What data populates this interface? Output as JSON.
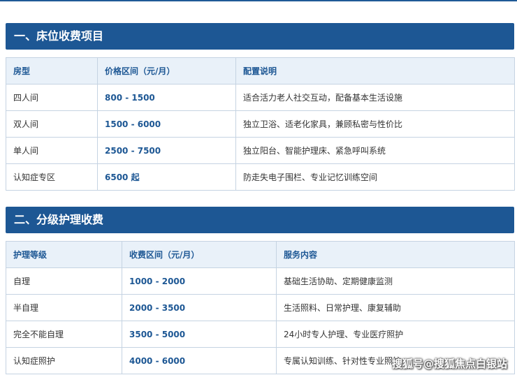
{
  "section1": {
    "title": "一、床位收费项目",
    "headers": [
      "房型",
      "价格区间（元/月）",
      "配置说明"
    ],
    "rows": [
      {
        "type": "四人间",
        "price": "800 - 1500",
        "desc": "适合活力老人社交互动，配备基本生活设施"
      },
      {
        "type": "双人间",
        "price": "1500 - 6000",
        "desc": "独立卫浴、适老化家具，兼顾私密与性价比"
      },
      {
        "type": "单人间",
        "price": "2500 - 7500",
        "desc": "独立阳台、智能护理床、紧急呼叫系统"
      },
      {
        "type": "认知症专区",
        "price": "6500 起",
        "desc": "防走失电子围栏、专业记忆训练空间"
      }
    ]
  },
  "section2": {
    "title": "二、分级护理收费",
    "headers": [
      "护理等级",
      "收费区间（元/月）",
      "服务内容"
    ],
    "rows": [
      {
        "level": "自理",
        "price": "1000 - 2000",
        "desc": "基础生活协助、定期健康监测"
      },
      {
        "level": "半自理",
        "price": "2000 - 3500",
        "desc": "生活照料、日常护理、康复辅助"
      },
      {
        "level": "完全不能自理",
        "price": "3500 - 5000",
        "desc": "24小时专人护理、专业医疗照护"
      },
      {
        "level": "认知症照护",
        "price": "4000 - 6000",
        "desc": "专属认知训练、针对性专业照护"
      }
    ]
  },
  "watermark": "搜狐号@搜狐焦点白银站"
}
